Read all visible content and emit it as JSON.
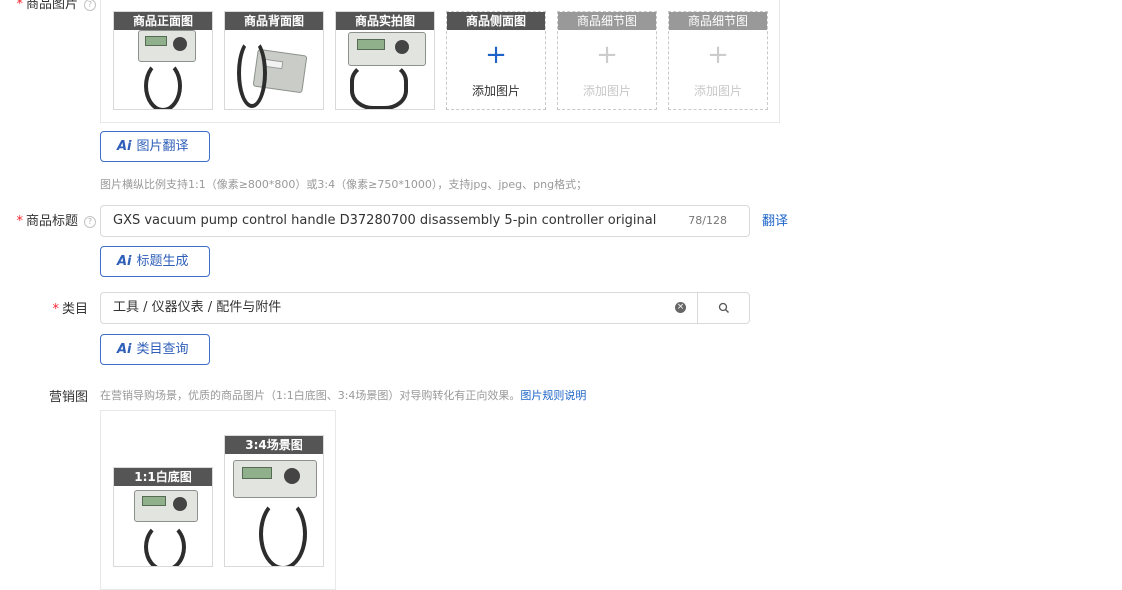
{
  "product_images": {
    "label": "商品图片",
    "slots": [
      {
        "label": "商品正面图",
        "state": "filled"
      },
      {
        "label": "商品背面图",
        "state": "filled"
      },
      {
        "label": "商品实拍图",
        "state": "filled"
      },
      {
        "label": "商品侧面图",
        "state": "empty",
        "add_text": "添加图片",
        "plus": "+"
      },
      {
        "label": "商品细节图",
        "state": "disabled",
        "add_text": "添加图片",
        "plus": "+"
      },
      {
        "label": "商品细节图",
        "state": "disabled",
        "add_text": "添加图片",
        "plus": "+"
      }
    ],
    "ai_button": {
      "icon": "Ai",
      "label": "图片翻译"
    },
    "hint": "图片横纵比例支持1:1（像素≥800*800）或3:4（像素≥750*1000），支持jpg、jpeg、png格式；"
  },
  "title_field": {
    "label": "商品标题",
    "value": "GXS vacuum pump control handle D37280700 disassembly 5-pin controller original",
    "counter": "78/128",
    "translate_link": "翻译",
    "ai_button": {
      "icon": "Ai",
      "label": "标题生成"
    }
  },
  "category_field": {
    "label": "类目",
    "value": "工具 / 仪器仪表 / 配件与附件",
    "ai_button": {
      "icon": "Ai",
      "label": "类目查询"
    }
  },
  "marketing": {
    "label": "营销图",
    "hint": "在营销导购场景，优质的商品图片（1:1白底图、3:4场景图）对导购转化有正向效果。",
    "rule_link": "图片规则说明",
    "slots": [
      {
        "label": "1:1白底图"
      },
      {
        "label": "3:4场景图"
      }
    ]
  },
  "colors": {
    "required": "#f5222d",
    "link": "#1e64c8",
    "ai_border": "#3d6fc9",
    "slot_label_bg": "#555555"
  },
  "icons": [
    "help-icon",
    "plus-icon",
    "ai-icon",
    "clear-icon",
    "search-icon"
  ]
}
